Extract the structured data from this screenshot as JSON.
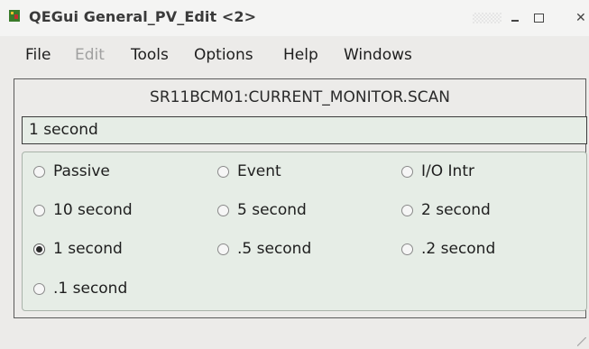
{
  "window": {
    "title": "QEGui General_PV_Edit <2>",
    "app_icon": "qegui-app-icon",
    "controls": {
      "minimize": "minimize-icon",
      "maximize": "maximize-icon",
      "close": "close-icon"
    }
  },
  "menubar": {
    "items": [
      {
        "label": "File",
        "enabled": true
      },
      {
        "label": "Edit",
        "enabled": false
      },
      {
        "label": "Tools",
        "enabled": true
      },
      {
        "label": "Options",
        "enabled": true
      },
      {
        "label": "Help",
        "enabled": true
      },
      {
        "label": "Windows",
        "enabled": true
      }
    ]
  },
  "editor": {
    "pv_name": "SR11BCM01:CURRENT_MONITOR.SCAN",
    "current_value": "1 second",
    "selected": "1 second",
    "options": [
      "Passive",
      "Event",
      "I/O Intr",
      "10 second",
      "5 second",
      "2 second",
      "1 second",
      ".5 second",
      ".2 second",
      ".1 second"
    ]
  },
  "colors": {
    "background": "#ecebe9",
    "field_background": "#e6ede6",
    "disabled_text": "#a0a0a0"
  }
}
